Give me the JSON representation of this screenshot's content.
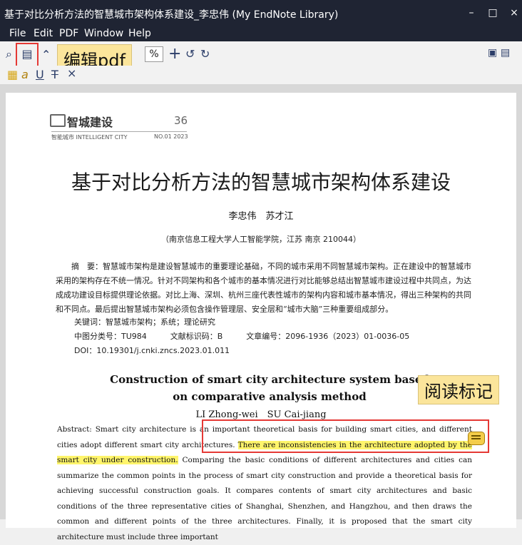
{
  "window": {
    "title": "基于对比分析方法的智慧城市架构体系建设_李忠伟 (My EndNote Library)",
    "minimize": "–",
    "maximize": "□",
    "close": "×"
  },
  "menu": [
    "File",
    "Edit",
    "PDF",
    "Window",
    "Help"
  ],
  "toolbar": {
    "zoom_value": "%",
    "zoom_plus": "+",
    "undo_label": "↺",
    "redo_label": "↻",
    "save_icon": "save-icon",
    "print_icon": "print-icon"
  },
  "annotation_toolbar": [
    "highlight-icon",
    "italic-a-icon",
    "underline-icon",
    "strikethrough-icon",
    "clear-icon"
  ],
  "callouts": {
    "edit_pdf": "编辑pdf",
    "read_marks": "阅读标记"
  },
  "document": {
    "journal_name": "智城建设",
    "page_number": "36",
    "journal_sub": "智能城市 INTELLIGENT CITY",
    "issue": "NO.01 2023",
    "title": "基于对比分析方法的智慧城市架构体系建设",
    "authors": "李忠伟　苏才江",
    "affiliation": "（南京信息工程大学人工智能学院，江苏 南京 210044）",
    "cn_abstract": "摘　要：智慧城市架构是建设智慧城市的重要理论基础，不同的城市采用不同智慧城市架构。正在建设中的智慧城市采用的架构存在不统一情况。针对不同架构和各个城市的基本情况进行对比能够总结出智慧城市建设过程中共同点，为达成成功建设目标提供理论依据。对比上海、深圳、杭州三座代表性城市的架构内容和城市基本情况，得出三种架构的共同和不同点。最后提出智慧城市架构必须包含操作管理层、安全层和“城市大脑”三种重要组成部分。",
    "keywords": "关键词：智慧城市架构；系统；理论研究",
    "classification": "中图分类号：TU984　　　文献标识码：B　　　文章编号：2096-1936（2023）01-0036-05",
    "doi": "DOI：10.19301/j.cnki.zncs.2023.01.011",
    "en_title": "Construction of smart city architecture system based on comparative analysis method",
    "en_authors": "LI Zhong-wei　SU Cai-jiang",
    "en_abstract_1": "Abstract: Smart city architecture is an important theoretical basis for building smart cities, and different cities adopt different smart city architectures.",
    "en_abstract_hl": "There are inconsistencies in the architecture adopted by the smart city under construction.",
    "en_abstract_2": "Comparing the basic conditions of different architectures and cities can summarize the common points in the process of smart city construction and provide a theoretical basis for achieving successful construction goals. It compares contents of smart city architectures and basic conditions of the three representative cities of Shanghai, Shenzhen, and Hangzhou, and then draws the common and different points of the three architectures. Finally, it is proposed that the smart city architecture must include three important"
  }
}
